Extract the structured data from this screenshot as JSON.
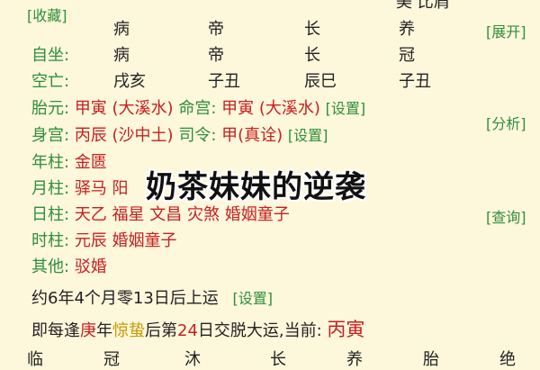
{
  "links": {
    "collect": "[收藏]",
    "expand": "[展开]",
    "analyze": "[分析]",
    "query": "[查询]",
    "settings": "[设置]"
  },
  "top_partial": "美 比肩",
  "row_changsheng": [
    "病",
    "帝",
    "长",
    "养"
  ],
  "row_zizuo": {
    "label": "自坐:",
    "values": [
      "病",
      "帝",
      "长",
      "冠"
    ]
  },
  "row_kongwang": {
    "label": "空亡:",
    "values": [
      "戌亥",
      "子丑",
      "辰巳",
      "子丑"
    ]
  },
  "taiyuan": {
    "label": "胎元:",
    "value": "甲寅 (大溪水)",
    "minggong_label": "命宫:",
    "minggong_value": "甲寅 (大溪水)"
  },
  "shengong": {
    "label": "身宫:",
    "value": "丙辰 (沙中土)",
    "siling_label": "司令:",
    "siling_value": "甲(真诠)"
  },
  "nianzhu": {
    "label": "年柱:",
    "items": [
      "金匮"
    ]
  },
  "yuezhu": {
    "label": "月柱:",
    "items": [
      "驿马",
      "阳"
    ]
  },
  "rizhu": {
    "label": "日柱:",
    "items": [
      "天乙",
      "福星",
      "文昌",
      "灾煞",
      "婚姻童子"
    ]
  },
  "shizhu": {
    "label": "时柱:",
    "items": [
      "元辰",
      "婚姻童子"
    ]
  },
  "qita": {
    "label": "其他:",
    "items": [
      "驳婚"
    ]
  },
  "overlay_title": "奶茶妹妹的逆袭",
  "qiyun": "约6年4个月零13日后上运",
  "jiaoyun": {
    "p1": "即每逢",
    "year": "庚",
    "p2": "年",
    "jieqi": "惊蛰",
    "p3": "后第",
    "day": "24",
    "p4": "日交脱大运,当前: ",
    "current": "丙寅"
  },
  "bottom_partial": [
    "临",
    "冠",
    "沐",
    "长",
    "养",
    "胎",
    "绝"
  ]
}
